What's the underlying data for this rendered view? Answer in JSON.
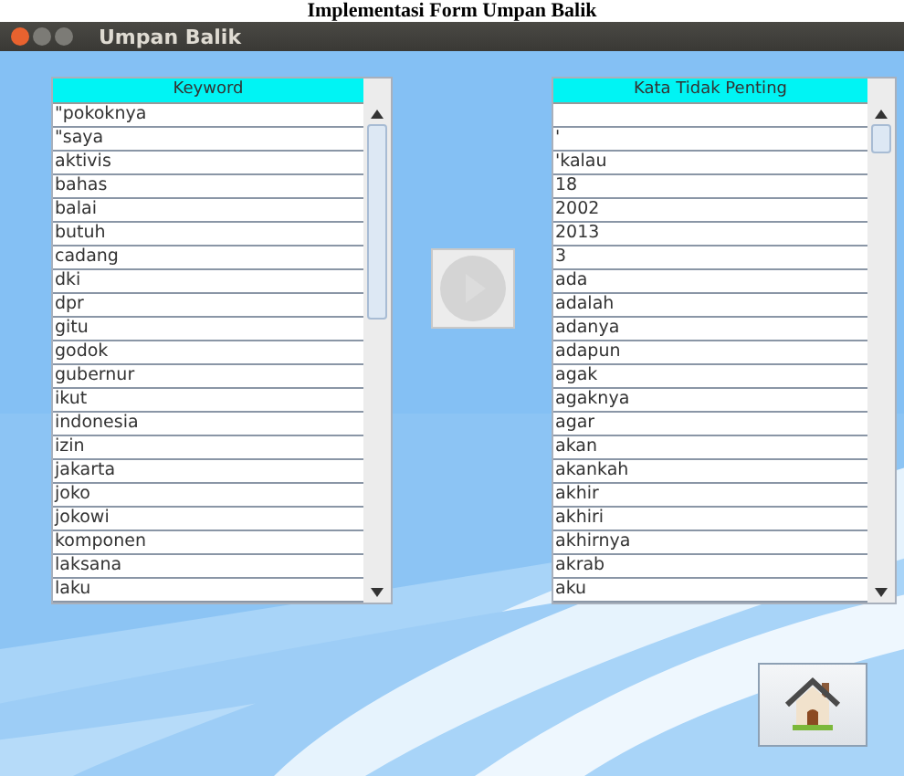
{
  "page_heading": "Implementasi Form Umpan Balik",
  "window": {
    "title": "Umpan Balik"
  },
  "lists": [
    {
      "header": "Keyword",
      "rows": [
        {
          "kind": "word",
          "text": "\"pokoknya"
        },
        {
          "kind": "word",
          "text": "\"saya"
        },
        {
          "kind": "word",
          "text": "aktivis"
        },
        {
          "kind": "word",
          "text": "bahas"
        },
        {
          "kind": "word",
          "text": "balai"
        },
        {
          "kind": "word",
          "text": "butuh"
        },
        {
          "kind": "word",
          "text": "cadang"
        },
        {
          "kind": "word",
          "text": "dki"
        },
        {
          "kind": "word",
          "text": "dpr"
        },
        {
          "kind": "word",
          "text": "gitu"
        },
        {
          "kind": "word",
          "text": "godok"
        },
        {
          "kind": "word",
          "text": "gubernur"
        },
        {
          "kind": "word",
          "text": "ikut"
        },
        {
          "kind": "word",
          "text": "indonesia"
        },
        {
          "kind": "word",
          "text": "izin"
        },
        {
          "kind": "word",
          "text": "jakarta"
        },
        {
          "kind": "word",
          "text": "joko"
        },
        {
          "kind": "word",
          "text": "jokowi"
        },
        {
          "kind": "word",
          "text": "komponen"
        },
        {
          "kind": "word",
          "text": "laksana"
        },
        {
          "kind": "word",
          "text": "laku"
        }
      ]
    },
    {
      "header": "Kata Tidak Penting",
      "rows": [
        {
          "kind": "empty"
        },
        {
          "kind": "word",
          "text": "'"
        },
        {
          "kind": "word",
          "text": "'kalau"
        },
        {
          "kind": "word",
          "text": "18"
        },
        {
          "kind": "word",
          "text": "2002"
        },
        {
          "kind": "word",
          "text": "2013"
        },
        {
          "kind": "word",
          "text": "3"
        },
        {
          "kind": "word",
          "text": "ada"
        },
        {
          "kind": "word",
          "text": "adalah"
        },
        {
          "kind": "word",
          "text": "adanya"
        },
        {
          "kind": "word",
          "text": "adapun"
        },
        {
          "kind": "word",
          "text": "agak"
        },
        {
          "kind": "word",
          "text": "agaknya"
        },
        {
          "kind": "word",
          "text": "agar"
        },
        {
          "kind": "word",
          "text": "akan"
        },
        {
          "kind": "word",
          "text": "akankah"
        },
        {
          "kind": "word",
          "text": "akhir"
        },
        {
          "kind": "word",
          "text": "akhiri"
        },
        {
          "kind": "word",
          "text": "akhirnya"
        },
        {
          "kind": "word",
          "text": "akrab"
        },
        {
          "kind": "word",
          "text": "aku"
        }
      ]
    }
  ],
  "transfer_button": {
    "disabled": true
  }
}
